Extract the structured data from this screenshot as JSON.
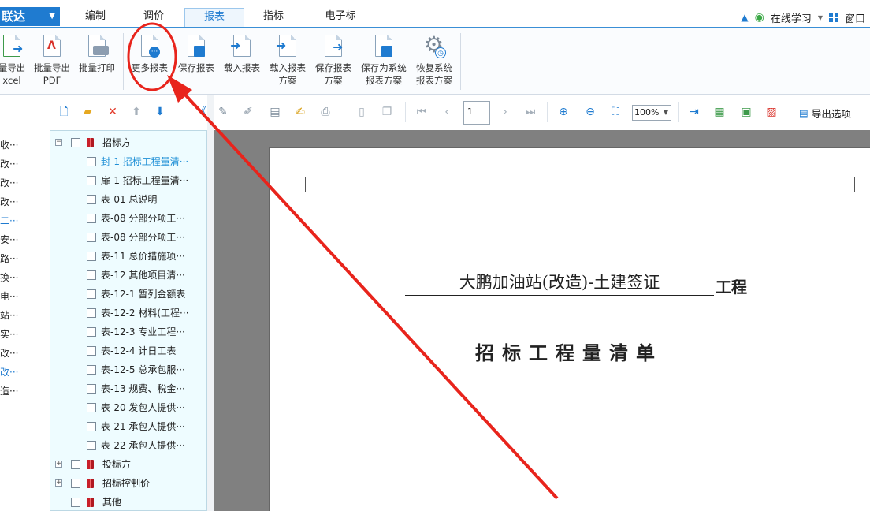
{
  "app": {
    "logo_text": "联达"
  },
  "menu": {
    "tabs": [
      {
        "label": "编制"
      },
      {
        "label": "调价"
      },
      {
        "label": "报表"
      },
      {
        "label": "指标"
      },
      {
        "label": "电子标"
      }
    ],
    "active_tab": "报表",
    "right": {
      "learn": "在线学习",
      "window": "窗口"
    }
  },
  "ribbon": {
    "buttons": [
      {
        "label1": "量导出",
        "label2": "xcel"
      },
      {
        "label1": "批量导出",
        "label2": "PDF"
      },
      {
        "label1": "批量打印",
        "label2": ""
      },
      {
        "label1": "更多报表",
        "label2": ""
      },
      {
        "label1": "保存报表",
        "label2": ""
      },
      {
        "label1": "载入报表",
        "label2": ""
      },
      {
        "label1": "载入报表",
        "label2": "方案"
      },
      {
        "label1": "保存报表",
        "label2": "方案"
      },
      {
        "label1": "保存为系统",
        "label2": "报表方案"
      },
      {
        "label1": "恢复系统",
        "label2": "报表方案"
      }
    ]
  },
  "toolbar": {
    "page_number": "1",
    "zoom": "100%",
    "export_options": "导出选项"
  },
  "left_strip": {
    "items": [
      "收···",
      "改···",
      "改···",
      "改···",
      "二···",
      "安···",
      "路···",
      "换···",
      "电···",
      "站···",
      "实···",
      "改···",
      "改···",
      "造···"
    ]
  },
  "tree": {
    "groups": [
      {
        "label": "招标方",
        "expanded": true,
        "children": [
          "封-1 招标工程量清···",
          "扉-1 招标工程量清···",
          "表-01 总说明",
          "表-08 分部分项工···",
          "表-08 分部分项工···",
          "表-11 总价措施项···",
          "表-12 其他项目清···",
          "表-12-1 暂列金额表",
          "表-12-2 材料(工程···",
          "表-12-3 专业工程···",
          "表-12-4 计日工表",
          "表-12-5 总承包服···",
          "表-13 规费、税金···",
          "表-20 发包人提供···",
          "表-21 承包人提供···",
          "表-22 承包人提供···"
        ],
        "selected_index": 0
      },
      {
        "label": "投标方",
        "expanded": false
      },
      {
        "label": "招标控制价",
        "expanded": false
      },
      {
        "label": "其他",
        "expanded": false
      }
    ]
  },
  "report_preview": {
    "project_name": "大鹏加油站(改造)-土建签证",
    "project_suffix": "工程",
    "document_title": "招标工程量清单"
  },
  "colors": {
    "accent": "#1f7bd0",
    "annotation": "#e8241c",
    "preview_bg": "#808080"
  }
}
